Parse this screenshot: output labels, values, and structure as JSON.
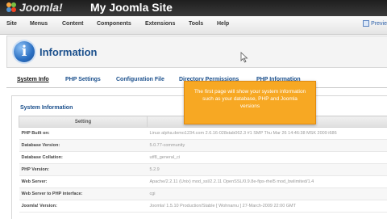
{
  "topbar": {
    "logo_text": "Joomla!",
    "site_title": "My Joomla Site"
  },
  "menu": {
    "items": [
      "Site",
      "Menus",
      "Content",
      "Components",
      "Extensions",
      "Tools",
      "Help"
    ],
    "preview": "Previe"
  },
  "header": {
    "title": "Information"
  },
  "tabs": [
    "System Info",
    "PHP Settings",
    "Configuration File",
    "Directory Permissions",
    "PHP Information"
  ],
  "tooltip": {
    "text": "The first page will show your system information such as your database, PHP and Joomla versions"
  },
  "panel": {
    "legend": "System Information",
    "column_setting": "Setting",
    "rows": [
      {
        "label": "PHP Built on:",
        "value": "Linux alpha.demo1234.com 2.6.16-028stab062.3 #1 SMP Thu Mar 26 14:46:38 MSK 2009 i686"
      },
      {
        "label": "Database Version:",
        "value": "5.0.77-community"
      },
      {
        "label": "Database Collation:",
        "value": "utf8_general_ci"
      },
      {
        "label": "PHP Version:",
        "value": "5.2.9"
      },
      {
        "label": "Web Server:",
        "value": "Apache/2.2.11 (Unix) mod_ssl/2.2.11 OpenSSL/0.9.8e-fips-rhel5 mod_bwlimited/1.4"
      },
      {
        "label": "Web Server to PHP interface:",
        "value": "cgi"
      },
      {
        "label": "Joomla! Version:",
        "value": "Joomla! 1.5.10 Production/Stable [ Wohnamu ] 27-March-2009 22:00 GMT"
      }
    ]
  }
}
